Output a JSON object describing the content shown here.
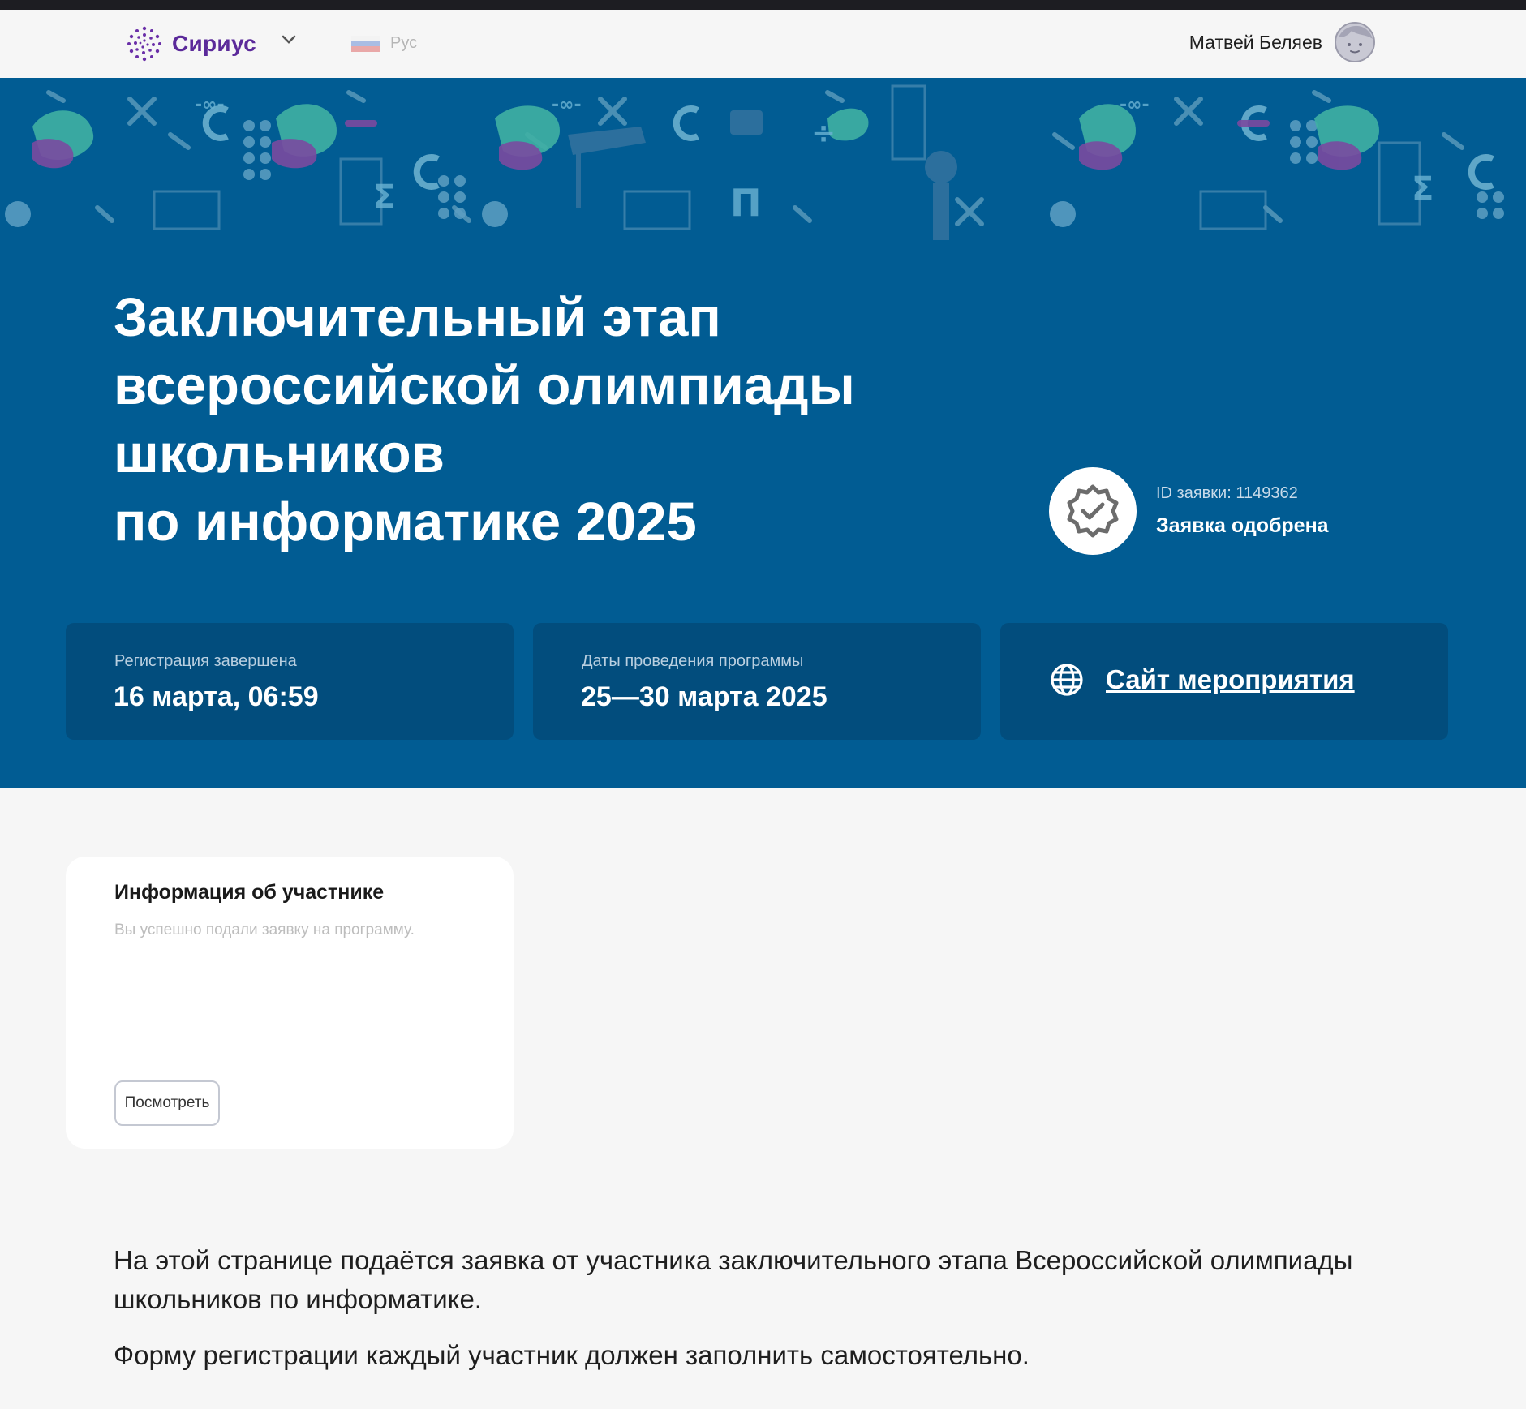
{
  "header": {
    "brand": "Сириус",
    "language": "Рус",
    "user_name": "Матвей Беляев"
  },
  "hero": {
    "title_lines": [
      "Заключительный этап",
      "всероссийской олимпиады",
      "школьников",
      "по информатике 2025"
    ],
    "application_id": "ID заявки: 1149362",
    "application_status": "Заявка одобрена"
  },
  "cards": {
    "registration": {
      "label": "Регистрация завершена",
      "value": "16 марта, 06:59"
    },
    "dates": {
      "label": "Даты проведения программы",
      "value": "25—30 марта 2025"
    },
    "site": {
      "label": "Сайт мероприятия"
    }
  },
  "participant": {
    "title": "Информация об участнике",
    "subtitle": "Вы успешно подали заявку на программу.",
    "button": "Посмотреть"
  },
  "description": [
    "На этой странице подаётся заявка от участника заключительного этапа Всероссийской олимпиады школьников по информатике.",
    "Форму регистрации каждый участник должен заполнить самостоятельно."
  ],
  "colors": {
    "hero_bg": "#015c93",
    "card_bg": "#024d7d",
    "brand": "#5b2a9a",
    "page_bg": "#f6f6f6"
  }
}
